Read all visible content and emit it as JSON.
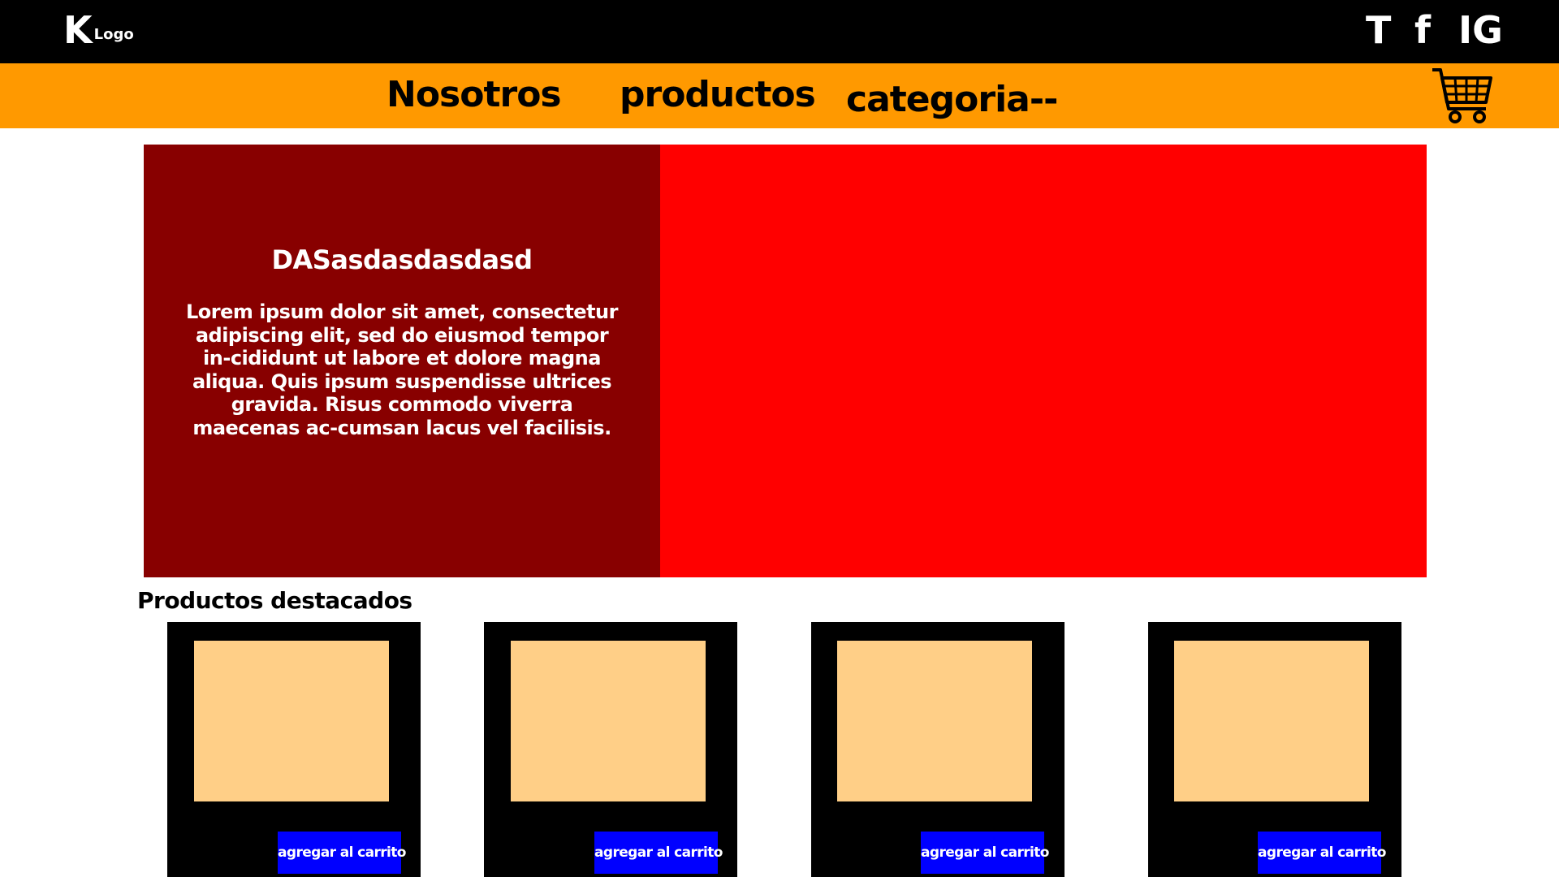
{
  "header": {
    "logo_mark": "K",
    "logo_text": "Logo",
    "social": [
      "T",
      "f",
      "IG"
    ]
  },
  "nav": {
    "links": [
      "Nosotros",
      "productos",
      "categoria--"
    ],
    "cart_icon": "shopping-cart-icon"
  },
  "hero": {
    "title": "DASasdasdasdasd",
    "text": "Lorem ipsum dolor sit amet, consectetur adipiscing elit, sed do eiusmod tempor in-cididunt ut labore et dolore magna aliqua. Quis ipsum suspendisse ultrices gravida. Risus commodo viverra maecenas ac-cumsan lacus vel facilisis."
  },
  "featured": {
    "title": "Productos destacados",
    "products": [
      {
        "button": "agregar al carrito"
      },
      {
        "button": "agregar al carrito"
      },
      {
        "button": "agregar al carrito"
      },
      {
        "button": "agregar al carrito"
      }
    ]
  },
  "colors": {
    "topbar": "#000000",
    "navbar": "#ff9900",
    "hero_left": "#880000",
    "hero_right": "#ff0000",
    "product_image": "#ffcf87",
    "button": "#0000ff"
  }
}
